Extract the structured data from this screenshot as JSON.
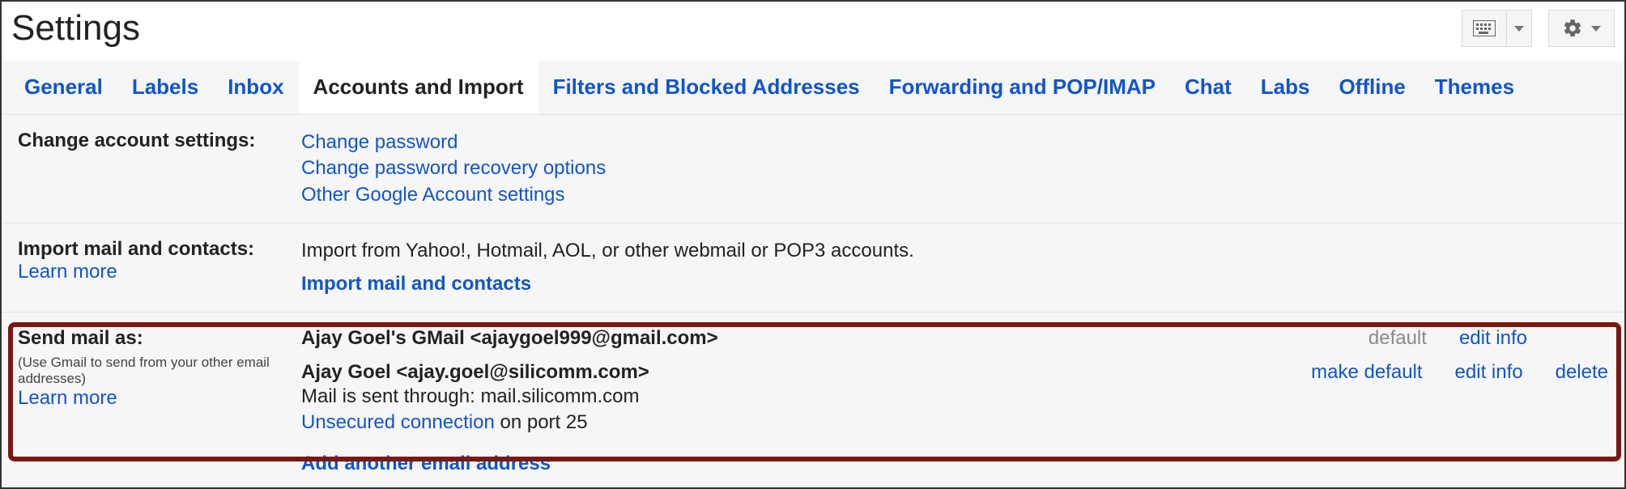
{
  "header": {
    "title": "Settings"
  },
  "tabs": [
    {
      "label": "General",
      "active": false
    },
    {
      "label": "Labels",
      "active": false
    },
    {
      "label": "Inbox",
      "active": false
    },
    {
      "label": "Accounts and Import",
      "active": true
    },
    {
      "label": "Filters and Blocked Addresses",
      "active": false
    },
    {
      "label": "Forwarding and POP/IMAP",
      "active": false
    },
    {
      "label": "Chat",
      "active": false
    },
    {
      "label": "Labs",
      "active": false
    },
    {
      "label": "Offline",
      "active": false
    },
    {
      "label": "Themes",
      "active": false
    }
  ],
  "section_change_account": {
    "label": "Change account settings:",
    "links": [
      "Change password",
      "Change password recovery options",
      "Other Google Account settings"
    ]
  },
  "section_import": {
    "label": "Import mail and contacts:",
    "learn_more": "Learn more",
    "description": "Import from Yahoo!, Hotmail, AOL, or other webmail or POP3 accounts.",
    "action_link": "Import mail and contacts"
  },
  "section_send_as": {
    "label": "Send mail as:",
    "sub": "(Use Gmail to send from your other email addresses)",
    "learn_more": "Learn more",
    "accounts": [
      {
        "display": "Ajay Goel's GMail <ajaygoel999@gmail.com>",
        "default_text": "default",
        "is_default": true,
        "edit": "edit info"
      },
      {
        "display": "Ajay Goel <ajay.goel@silicomm.com>",
        "sent_through_prefix": "Mail is sent through: ",
        "sent_through_host": "mail.silicomm.com",
        "unsecured": "Unsecured connection",
        "port_suffix": " on port 25",
        "make_default": "make default",
        "edit": "edit info",
        "delete": "delete"
      }
    ],
    "add_another": "Add another email address"
  }
}
